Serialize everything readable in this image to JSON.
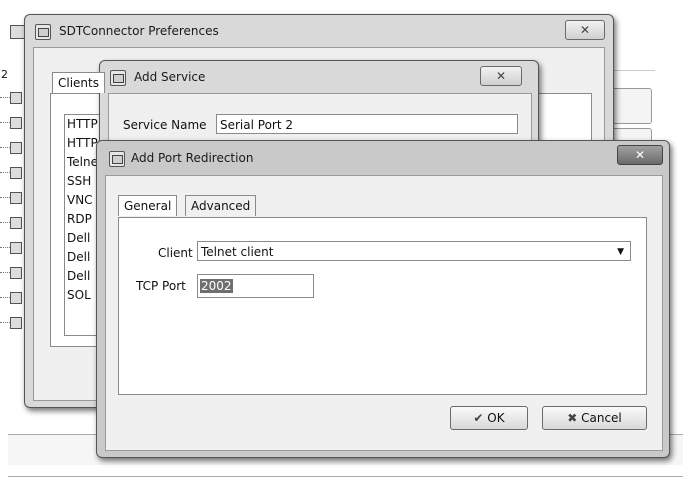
{
  "background_app": {
    "partial_text": "2"
  },
  "prefs_window": {
    "title": "SDTConnector Preferences",
    "close_label": "✕",
    "tab_clients": "Clients",
    "clients_list": [
      "HTTP",
      "HTTP",
      "Telnet",
      "SSH",
      "VNC",
      "RDP",
      "Dell",
      "Dell",
      "Dell",
      "SOL"
    ]
  },
  "add_service_window": {
    "title": "Add Service",
    "close_label": "✕",
    "service_name_label": "Service Name",
    "service_name_value": "Serial Port 2"
  },
  "add_port_window": {
    "title": "Add Port Redirection",
    "close_label": "✕",
    "tabs": [
      "General",
      "Advanced"
    ],
    "client_label": "Client",
    "client_value": "Telnet client",
    "tcp_port_label": "TCP Port",
    "tcp_port_value": "2002",
    "ok_label": "OK",
    "cancel_label": "Cancel"
  }
}
